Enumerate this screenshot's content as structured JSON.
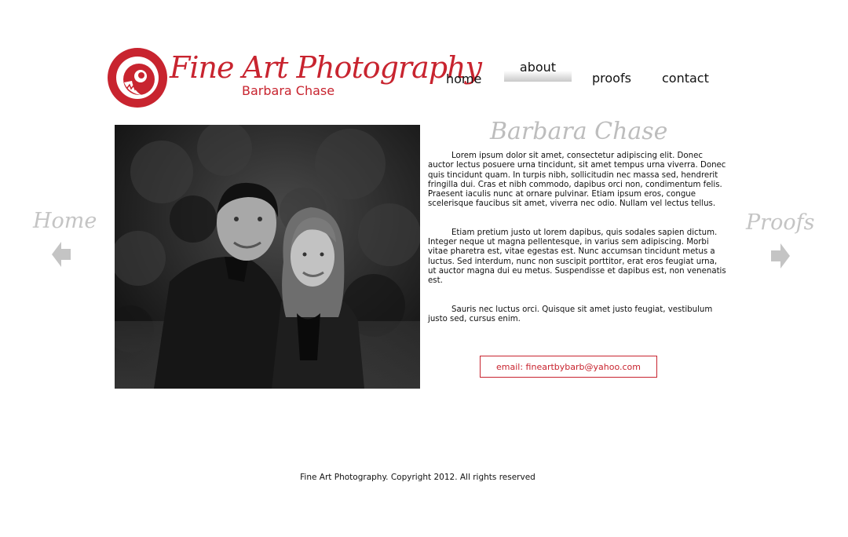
{
  "brand": {
    "title": "Fine Art Photography",
    "subtitle": "Barbara Chase",
    "color": "#c8242f"
  },
  "nav": {
    "items": [
      {
        "label": "home",
        "active": false
      },
      {
        "label": "about",
        "active": true
      },
      {
        "label": "proofs",
        "active": false
      },
      {
        "label": "contact",
        "active": false
      }
    ]
  },
  "about": {
    "heading": "Barbara Chase",
    "paragraphs": [
      "Lorem ipsum dolor sit amet, consectetur adipiscing elit. Donec auctor lectus posuere urna tincidunt, sit amet tempus urna viverra. Donec quis tincidunt quam. In turpis nibh, sollicitudin nec massa sed, hendrerit fringilla dui. Cras et nibh commodo, dapibus orci non, condimentum felis. Praesent iaculis nunc at ornare pulvinar. Etiam ipsum eros, congue scelerisque faucibus sit amet, viverra nec odio. Nullam vel lectus tellus.",
      "Etiam pretium justo ut lorem dapibus, quis sodales sapien dictum. Integer neque ut magna pellentesque, in varius sem adipiscing. Morbi vitae pharetra est, vitae egestas est. Nunc accumsan tincidunt metus a luctus. Sed interdum, nunc non suscipit porttitor, erat eros feugiat urna, ut auctor magna dui eu metus. Suspendisse et dapibus est, non venenatis est.",
      "Sauris nec luctus orci. Quisque sit amet justo feugiat, vestibulum justo sed, cursus enim."
    ],
    "email": "email: fineartbybarb@yahoo.com"
  },
  "side_nav": {
    "prev_label": "Home",
    "next_label": "Proofs",
    "prev_icon": "arrow-left-icon",
    "next_icon": "arrow-right-icon"
  },
  "footer": {
    "text": "Fine Art Photography. Copyright 2012. All rights reserved"
  }
}
